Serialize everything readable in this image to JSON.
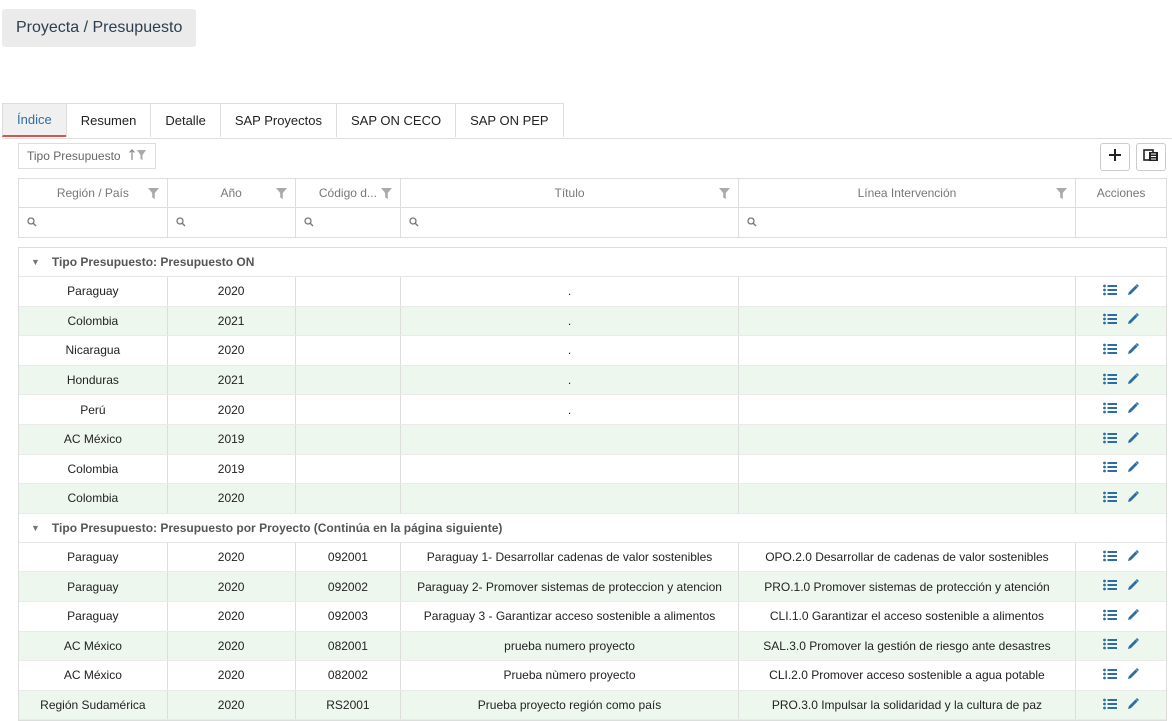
{
  "breadcrumb": {
    "root": "Proyecta",
    "sep": "/",
    "current": "Presupuesto"
  },
  "tabs": [
    "Índice",
    "Resumen",
    "Detalle",
    "SAP Proyectos",
    "SAP ON CECO",
    "SAP ON PEP"
  ],
  "group_panel": {
    "chip_label": "Tipo Presupuesto"
  },
  "columns": [
    "Región / País",
    "Año",
    "Código d...",
    "Título",
    "Línea Intervención",
    "Acciones"
  ],
  "groups": [
    {
      "label": "Tipo Presupuesto: Presupuesto ON",
      "rows": [
        [
          "Paraguay",
          "2020",
          "",
          ".",
          ""
        ],
        [
          "Colombia",
          "2021",
          "",
          ".",
          ""
        ],
        [
          "Nicaragua",
          "2020",
          "",
          ".",
          ""
        ],
        [
          "Honduras",
          "2021",
          "",
          ".",
          ""
        ],
        [
          "Perú",
          "2020",
          "",
          ".",
          ""
        ],
        [
          "AC México",
          "2019",
          "",
          "",
          ""
        ],
        [
          "Colombia",
          "2019",
          "",
          "",
          ""
        ],
        [
          "Colombia",
          "2020",
          "",
          "",
          ""
        ]
      ]
    },
    {
      "label": "Tipo Presupuesto: Presupuesto por Proyecto (Continúa en la página siguiente)",
      "rows": [
        [
          "Paraguay",
          "2020",
          "092001",
          "Paraguay 1- Desarrollar cadenas de valor sostenibles",
          "OPO.2.0 Desarrollar de cadenas de valor sostenibles"
        ],
        [
          "Paraguay",
          "2020",
          "092002",
          "Paraguay 2- Promover sistemas de proteccion y atencion",
          "PRO.1.0 Promover sistemas de protección y atención"
        ],
        [
          "Paraguay",
          "2020",
          "092003",
          "Paraguay 3 - Garantizar acceso sostenible a alimentos",
          "CLI.1.0 Garantizar el acceso sostenible a alimentos"
        ],
        [
          "AC México",
          "2020",
          "082001",
          "prueba numero proyecto",
          "SAL.3.0 Promover la gestión de riesgo ante desastres"
        ],
        [
          "AC México",
          "2020",
          "082002",
          "Prueba nùmero proyecto",
          "CLI.2.0 Promover acceso sostenible a agua potable"
        ],
        [
          "Región Sudamérica",
          "2020",
          "RS2001",
          "Prueba proyecto región como país",
          "PRO.3.0 Impulsar la solidaridad y la cultura de paz"
        ]
      ]
    }
  ],
  "colors": {
    "accent_blue": "#2e6da4",
    "active_tab_underline": "#d9534f",
    "alt_row": "#eef7ee"
  }
}
